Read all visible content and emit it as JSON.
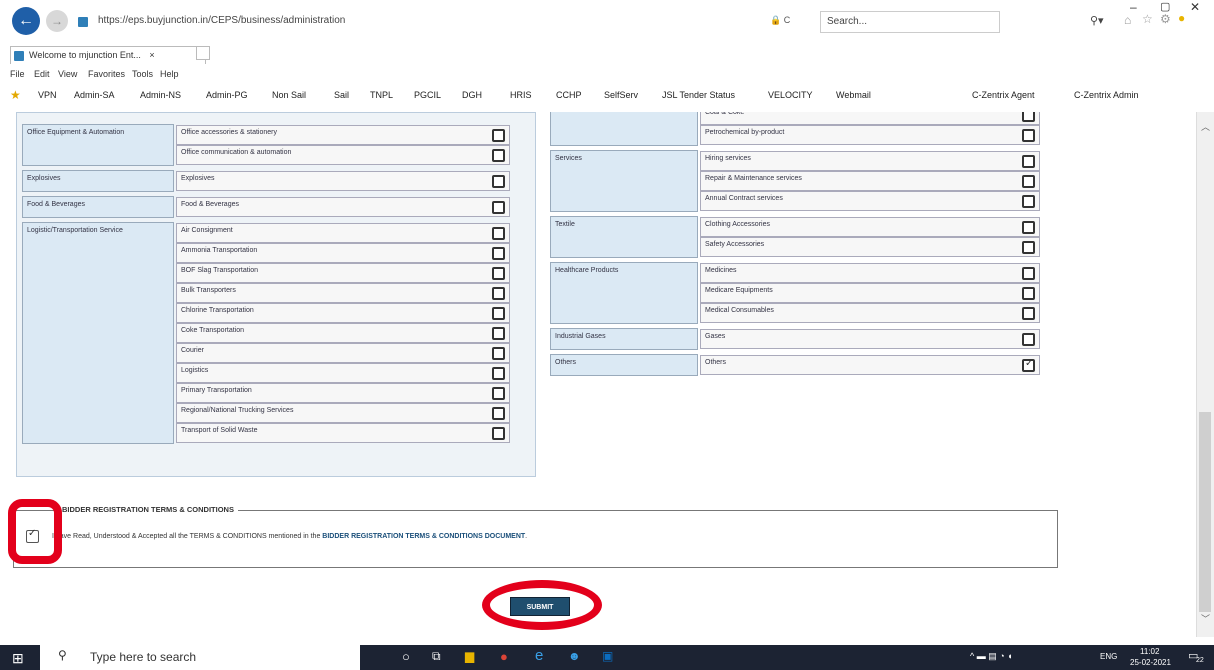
{
  "browser": {
    "url": "https://eps.buyjunction.in/CEPS/business/administration",
    "url_lock": "🔒 C",
    "search_placeholder": "Search...",
    "tab_title": "Welcome to mjunction Ent...",
    "menu": [
      "File",
      "Edit",
      "View",
      "Favorites",
      "Tools",
      "Help"
    ],
    "favorites": [
      "VPN",
      "Admin-SA",
      "Admin-NS",
      "Admin-PG",
      "Non Sail",
      "Sail",
      "TNPL",
      "PGCIL",
      "DGH",
      "HRIS",
      "CCHP",
      "SelfServ",
      "JSL Tender Status",
      "VELOCITY",
      "Webmail",
      "C-Zentrix Agent",
      "C-Zentrix Admin"
    ]
  },
  "left_groups": [
    {
      "category": "Office Equipment & Automation",
      "items": [
        {
          "label": "Office accessories & stationery",
          "checked": false
        },
        {
          "label": "Office communication & automation",
          "checked": false
        }
      ]
    },
    {
      "category": "Explosives",
      "items": [
        {
          "label": "Explosives",
          "checked": false
        }
      ]
    },
    {
      "category": "Food & Beverages",
      "items": [
        {
          "label": "Food & Beverages",
          "checked": false
        }
      ]
    },
    {
      "category": "Logistic/Transportation Service",
      "items": [
        {
          "label": "Air Consignment",
          "checked": false
        },
        {
          "label": "Ammonia Transportation",
          "checked": false
        },
        {
          "label": "BOF Slag Transportation",
          "checked": false
        },
        {
          "label": "Bulk Transporters",
          "checked": false
        },
        {
          "label": "Chlorine Transportation",
          "checked": false
        },
        {
          "label": "Coke Transportation",
          "checked": false
        },
        {
          "label": "Courier",
          "checked": false
        },
        {
          "label": "Logistics",
          "checked": false
        },
        {
          "label": "Primary Transportation",
          "checked": false
        },
        {
          "label": "Regional/National Trucking Services",
          "checked": false
        },
        {
          "label": "Transport of Solid Waste",
          "checked": false
        }
      ]
    }
  ],
  "right_groups": [
    {
      "category": "",
      "items": [
        {
          "label": "Coal & Coke",
          "checked": false
        },
        {
          "label": "Petrochemical by-product",
          "checked": false
        }
      ]
    },
    {
      "category": "Services",
      "items": [
        {
          "label": "Hiring services",
          "checked": false
        },
        {
          "label": "Repair & Maintenance services",
          "checked": false
        },
        {
          "label": "Annual Contract services",
          "checked": false
        }
      ]
    },
    {
      "category": "Textile",
      "items": [
        {
          "label": "Clothing Accessories",
          "checked": false
        },
        {
          "label": "Safety Accessories",
          "checked": false
        }
      ]
    },
    {
      "category": "Healthcare Products",
      "items": [
        {
          "label": "Medicines",
          "checked": false
        },
        {
          "label": "Medicare Equipments",
          "checked": false
        },
        {
          "label": "Medical Consumables",
          "checked": false
        }
      ]
    },
    {
      "category": "Industrial Gases",
      "items": [
        {
          "label": "Gases",
          "checked": false
        }
      ]
    },
    {
      "category": "Others",
      "items": [
        {
          "label": "Others",
          "checked": true
        }
      ]
    }
  ],
  "terms": {
    "legend": "BIDDER REGISTRATION TERMS & CONDITIONS",
    "text": "I have Read, Understood & Accepted all the TERMS & CONDITIONS mentioned in the",
    "link": "BIDDER REGISTRATION TERMS & CONDITIONS DOCUMENT",
    "checked": true
  },
  "submit_label": "SUBMIT",
  "taskbar": {
    "search_placeholder": "Type here to search",
    "language": "ENG",
    "time": "11:02",
    "date": "25-02-2021",
    "notification_count": "22"
  }
}
